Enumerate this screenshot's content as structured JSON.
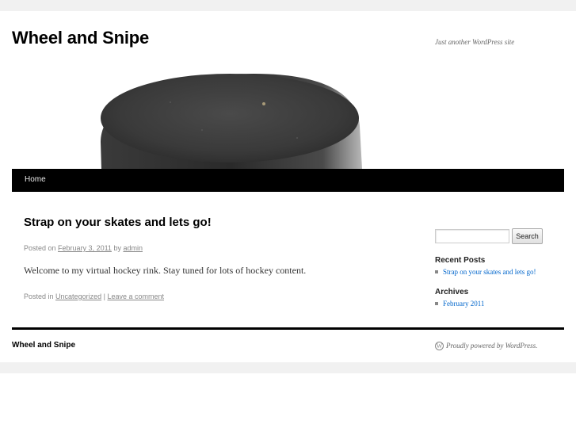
{
  "site": {
    "title": "Wheel and Snipe",
    "description": "Just another WordPress site"
  },
  "nav": {
    "items": [
      {
        "label": "Home"
      }
    ]
  },
  "post": {
    "title": "Strap on your skates and lets go!",
    "meta": {
      "posted_on": "Posted on",
      "date": "February 3, 2011",
      "by": "by",
      "author": "admin"
    },
    "content": "Welcome to my virtual hockey rink. Stay tuned for lots of hockey content.",
    "utility": {
      "posted_in": "Posted in",
      "category": "Uncategorized",
      "separator": "|",
      "comment_link": "Leave a comment"
    }
  },
  "sidebar": {
    "search_button": "Search",
    "search_value": "",
    "recent_posts": {
      "title": "Recent Posts",
      "items": [
        "Strap on your skates and lets go!"
      ]
    },
    "archives": {
      "title": "Archives",
      "items": [
        "February 2011"
      ]
    }
  },
  "footer": {
    "site_title": "Wheel and Snipe",
    "powered_by": "Proudly powered by WordPress."
  },
  "colors": {
    "link": "#0066cc",
    "nav_bg": "#000000",
    "page_bg": "#f1f1f1"
  }
}
